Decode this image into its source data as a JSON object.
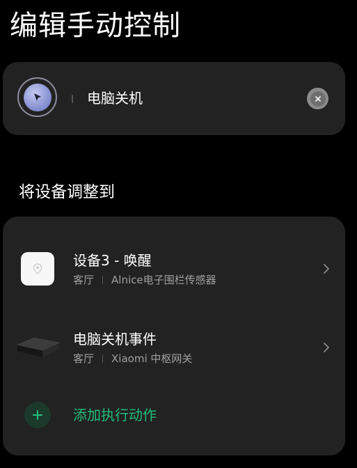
{
  "header": {
    "title": "编辑手动控制"
  },
  "scene": {
    "name": "电脑关机",
    "icon": "cursor-arrow-icon",
    "clear_icon": "close-icon"
  },
  "section": {
    "title": "将设备调整到"
  },
  "actions": [
    {
      "title": "设备3 - 唤醒",
      "room": "客厅",
      "device": "Alnice电子围栏传感器",
      "thumb": "sensor-device-icon"
    },
    {
      "title": "电脑关机事件",
      "room": "客厅",
      "device": "Xiaomi 中枢网关",
      "thumb": "gateway-device-icon"
    }
  ],
  "add_action": {
    "label": "添加执行动作",
    "icon": "plus-icon"
  },
  "colors": {
    "background": "#000000",
    "card": "#222222",
    "accent": "#1fbf7a",
    "secondary_text": "#a0a0a0"
  }
}
